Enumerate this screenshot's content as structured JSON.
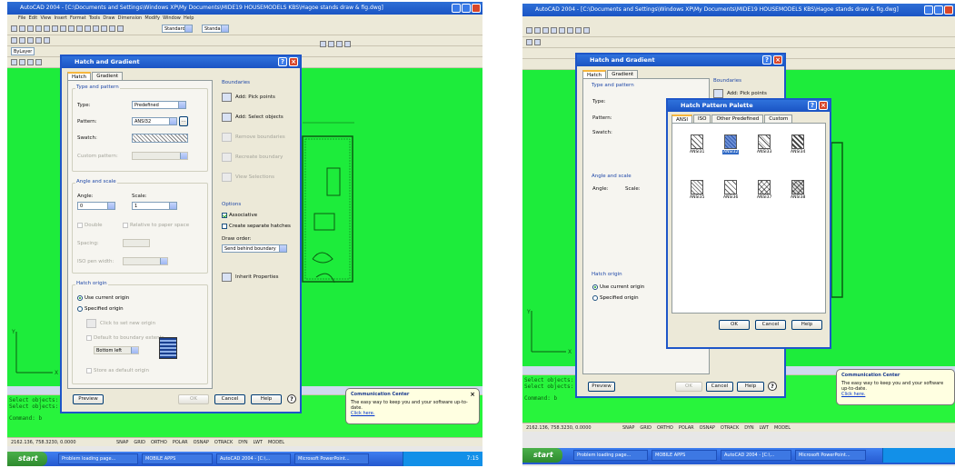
{
  "left": {
    "window_title": "AutoCAD 2004 - [C:\\Documents and Settings\\Windows XP\\My Documents\\MIDE19 HOUSEMODELS KBS\\Hagoe stands draw & fig.dwg]",
    "menu": [
      "File",
      "Edit",
      "View",
      "Insert",
      "Format",
      "Tools",
      "Draw",
      "Dimension",
      "Modify",
      "Window",
      "Help"
    ],
    "style_combo": "Standard",
    "layer_combo": "ByLayer",
    "dialog": {
      "title": "Hatch and Gradient",
      "tabs": [
        "Hatch",
        "Gradient"
      ],
      "type_pattern": {
        "legend": "Type and pattern",
        "type_label": "Type:",
        "type_value": "Predefined",
        "pattern_label": "Pattern:",
        "pattern_value": "ANSI32",
        "swatch_label": "Swatch:",
        "custom_label": "Custom pattern:"
      },
      "angle_scale": {
        "legend": "Angle and scale",
        "angle_label": "Angle:",
        "angle_value": "0",
        "scale_label": "Scale:",
        "scale_value": "1",
        "double_label": "Double",
        "relative_label": "Relative to paper space",
        "spacing_label": "Spacing:",
        "iso_label": "ISO pen width:"
      },
      "hatch_origin": {
        "legend": "Hatch origin",
        "use_current": "Use current origin",
        "specified": "Specified origin",
        "click_set": "Click to set new origin",
        "default_extents": "Default to boundary extents",
        "bottom_left": "Bottom left",
        "store_default": "Store as default origin"
      },
      "boundaries": {
        "legend": "Boundaries",
        "add_pick": "Add: Pick points",
        "add_select": "Add: Select objects",
        "remove": "Remove boundaries",
        "recreate": "Recreate boundary",
        "view_selections": "View Selections"
      },
      "options": {
        "legend": "Options",
        "associative": "Associative",
        "separate": "Create separate hatches",
        "draw_order_label": "Draw order:",
        "draw_order_value": "Send behind boundary",
        "inherit": "Inherit Properties"
      },
      "buttons": {
        "preview": "Preview",
        "ok": "OK",
        "cancel": "Cancel",
        "help": "Help",
        "more": "?"
      }
    },
    "command_lines": [
      "Select objects:",
      "Select objects:",
      "",
      "Command: b"
    ],
    "status_coords": "2162.136, 758.3230, 0.0000",
    "status_toggles": [
      "SNAP",
      "GRID",
      "ORTHO",
      "POLAR",
      "OSNAP",
      "OTRACK",
      "DYN",
      "LWT",
      "MODEL"
    ],
    "balloon": {
      "title": "Communication Center",
      "body": "The easy way to keep you and your software up-to-date.",
      "link": "Click here."
    },
    "taskbar": {
      "start": "start",
      "tasks": [
        "Problem loading page...",
        "MOBILE APPS",
        "AutoCAD 2004 - [C:\\...",
        "Microsoft PowerPoint..."
      ],
      "clock": "7:15"
    }
  },
  "right": {
    "dialog_behind_title": "Hatch and Gradient",
    "palette": {
      "title": "Hatch Pattern Palette",
      "tabs": [
        "ANSI",
        "ISO",
        "Other Predefined",
        "Custom"
      ],
      "patterns": [
        {
          "name": "ANSI31",
          "selected": false
        },
        {
          "name": "ANSI32",
          "selected": true
        },
        {
          "name": "ANSI33",
          "selected": false
        },
        {
          "name": "ANSI34",
          "selected": false
        },
        {
          "name": "ANSI35",
          "selected": false
        },
        {
          "name": "ANSI36",
          "selected": false
        },
        {
          "name": "ANSI37",
          "selected": false
        },
        {
          "name": "ANSI38",
          "selected": false
        }
      ],
      "buttons": {
        "ok": "OK",
        "cancel": "Cancel",
        "help": "Help"
      }
    },
    "balloon": {
      "title": "Communication Center",
      "body": "The easy way to keep you and your software up-to-date.",
      "link": "Click here."
    },
    "taskbar": {
      "start": "start",
      "tasks": [
        "Problem loading page...",
        "MOBILE APPS",
        "AutoCAD 2004 - [C:\\...",
        "Microsoft PowerPoint..."
      ]
    }
  }
}
